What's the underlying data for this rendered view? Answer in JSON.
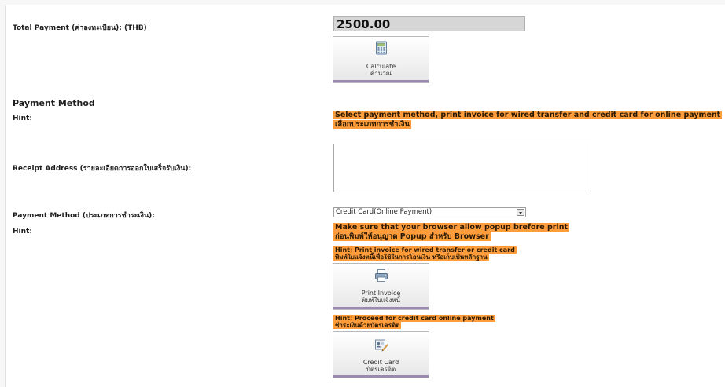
{
  "total_payment": {
    "label": "Total Payment (ค่าลงทะเบียน): (THB)",
    "value": "2500.00"
  },
  "calculate_button": {
    "label_en": "Calculate",
    "label_th": "คำนวณ",
    "icon": "calculator-icon"
  },
  "payment_method_section": {
    "title": "Payment Method",
    "hint_label": "Hint:",
    "hint_line1": "Select payment method, print invoice for wired transfer and credit card for online payment",
    "hint_line2": "เลือกประเภทการชำเงิน"
  },
  "receipt_address": {
    "label": "Receipt Address (รายละเอียดการออกใบเสร็จรับเงิน):",
    "value": ""
  },
  "payment_method_field": {
    "label": "Payment Method (ประเภทการชำระเงิน):",
    "selected": "Credit Card(Online Payment)"
  },
  "popup_hint": {
    "label": "Hint:",
    "line1": "Make sure that your browser allow popup brefore print",
    "line2": "ก่อนพิมพ์ให้อนุญาต Popup สำหรับ Browser"
  },
  "invoice_hint": {
    "line1": "Hint: Print invoice for wired transfer or credit card",
    "line2": "พิมพ์ใบแจ้งหนี้เพื่อใช้ในการโอนเงิน หรือเก็บเป็นหลักฐาน"
  },
  "print_invoice_button": {
    "label_en": "Print Invoice",
    "label_th": "พิมพ์ใบแจ้งหนี้",
    "icon": "printer-icon"
  },
  "credit_hint": {
    "line1": "Hint: Proceed for credit card online payment",
    "line2": "ชำระเงินด้วยบัตรเครดิต"
  },
  "credit_card_button": {
    "label_en": "Credit Card",
    "label_th": "บัตรเครดิต",
    "icon": "credit-card-icon"
  },
  "colors": {
    "hint_bg": "#ff9d3d",
    "amount_bg": "#d6d6d6",
    "button_accent": "#9a8ab0"
  }
}
